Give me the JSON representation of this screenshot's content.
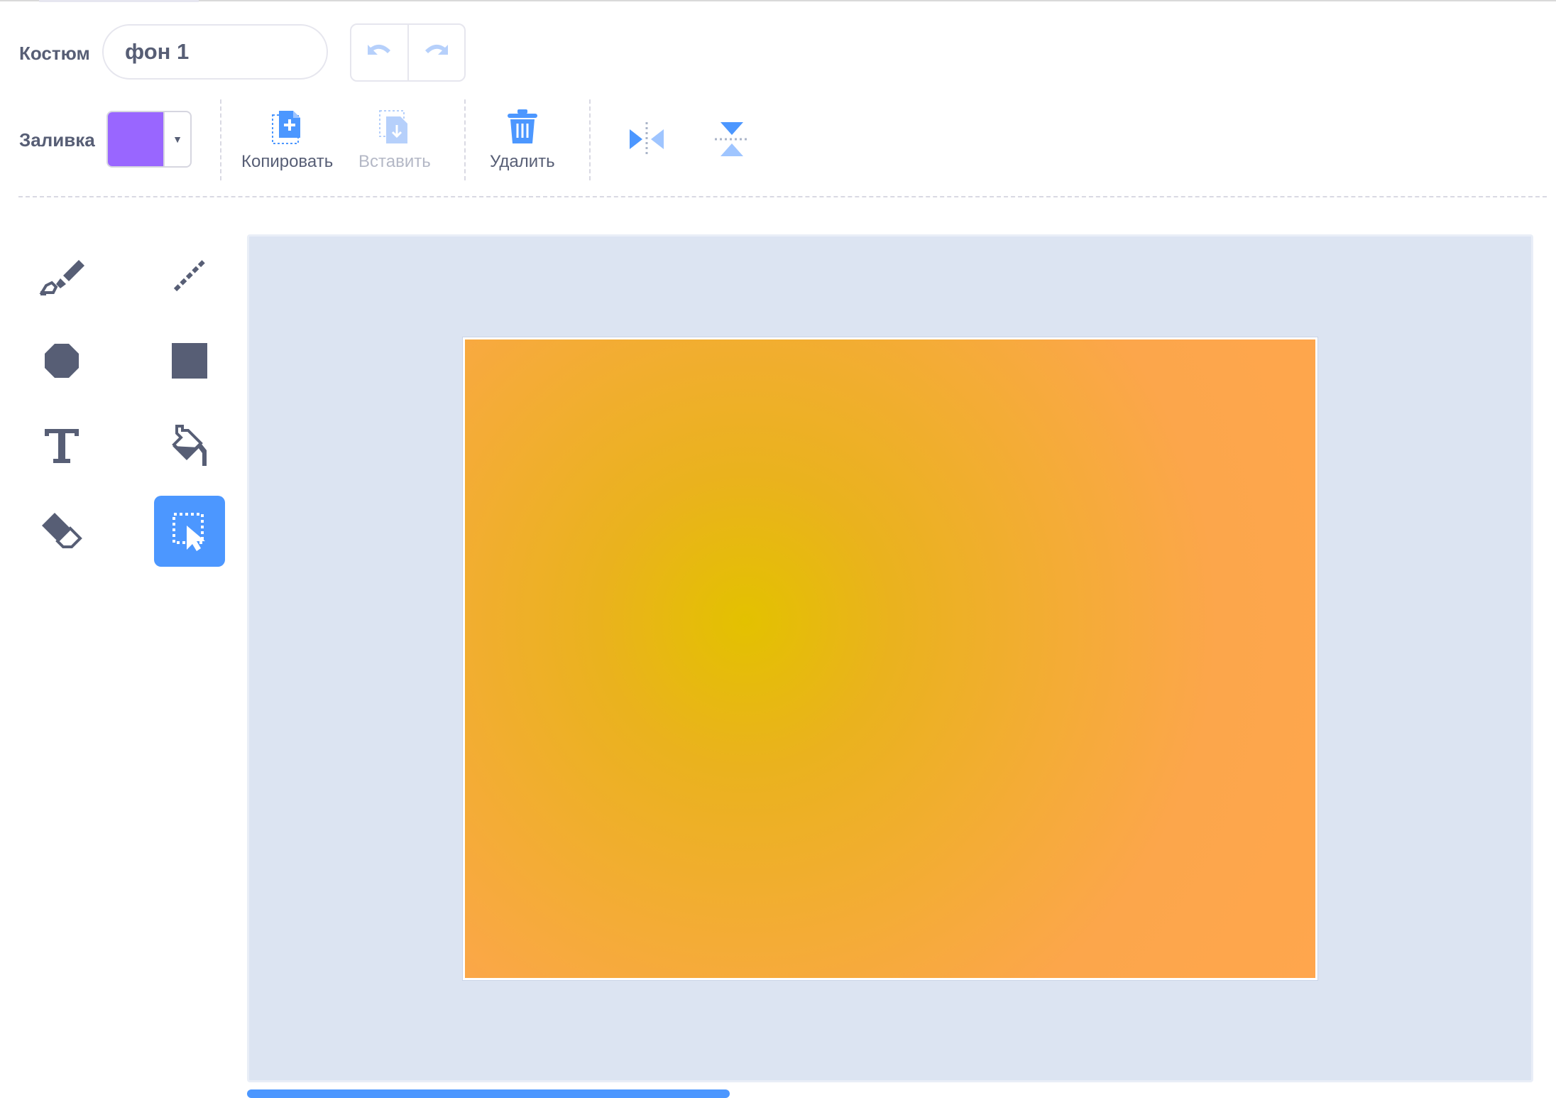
{
  "header": {
    "costume_label": "Костюм",
    "costume_name": "фон 1"
  },
  "fill": {
    "label": "Заливка",
    "color": "#9966ff"
  },
  "actions": {
    "copy": "Копировать",
    "paste": "Вставить",
    "delete": "Удалить"
  },
  "colors": {
    "accent": "#4c97ff",
    "tool_icon": "#575e75",
    "canvas_background": "#dce4f2",
    "costume_fill": "#ffa64d"
  },
  "tools": [
    {
      "name": "brush-icon",
      "selected": false
    },
    {
      "name": "line-icon",
      "selected": false
    },
    {
      "name": "circle-icon",
      "selected": false
    },
    {
      "name": "rectangle-icon",
      "selected": false
    },
    {
      "name": "text-icon",
      "selected": false
    },
    {
      "name": "fill-bucket-icon",
      "selected": false
    },
    {
      "name": "eraser-icon",
      "selected": false
    },
    {
      "name": "select-icon",
      "selected": true
    }
  ]
}
